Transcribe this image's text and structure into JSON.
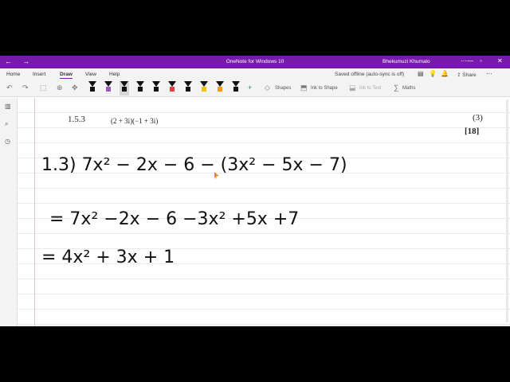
{
  "window": {
    "title": "OneNote for Windows 10",
    "user": "Bhekumuzi Khumalo"
  },
  "menu": {
    "items": [
      "Home",
      "Insert",
      "Draw",
      "View",
      "Help"
    ],
    "active": "Draw",
    "save_status": "Saved offline (auto-sync is off)",
    "share_label": "Share"
  },
  "toolbar": {
    "shapes_label": "Shapes",
    "ink_to_shape_label": "Ink to Shape",
    "ink_to_text_label": "Ink to Text",
    "maths_label": "Maths",
    "pen_colors": [
      "#111111",
      "#9b59b6",
      "#111111",
      "#111111",
      "#111111",
      "#e8413c",
      "#111111",
      "#f5c400",
      "#f39c12",
      "#111111"
    ]
  },
  "page": {
    "question_number": "1.5.3",
    "expression": "(2 + 3i)(−1 + 3i)",
    "marks": "(3)",
    "total": "[18]"
  },
  "ink": {
    "line1": "1.3)  7x² − 2x − 6  −  (3x² − 5x − 7)",
    "line2": "=  7x² −2x − 6  −3x² +5x  +7",
    "line3": "=   4x²  +  3x + 1"
  }
}
